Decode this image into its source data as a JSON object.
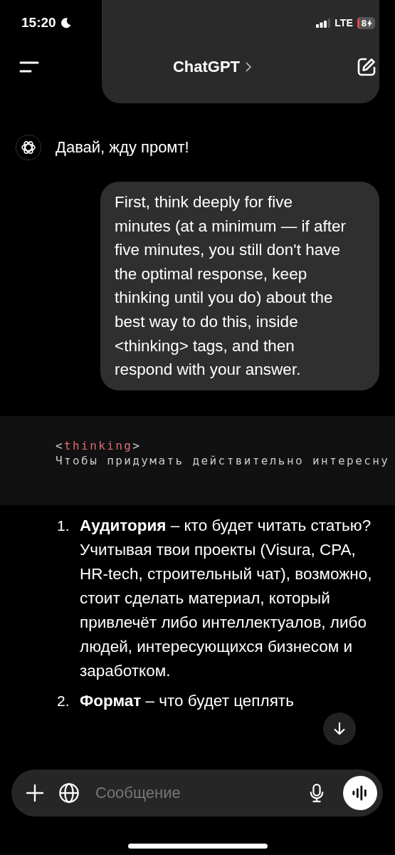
{
  "status_bar": {
    "time": "15:20",
    "network": "LTE",
    "battery": "8"
  },
  "header": {
    "title": "ChatGPT"
  },
  "assistant_reply": {
    "text": "Давай, жду промт!"
  },
  "user_message": {
    "text": "First, think deeply for five minutes (at a minimum — if after five minutes, you still don't have the optimal response, keep thinking until you do) about the best way to do this, inside <thinking> tags, and then respond with your answer."
  },
  "code_block": {
    "lines": [
      [
        {
          "kind": "punct",
          "text": "<"
        },
        {
          "kind": "tag",
          "text": "thinking"
        },
        {
          "kind": "punct",
          "text": ">"
        }
      ],
      [
        {
          "kind": "plain",
          "text": "Чтобы придумать действительно интересну"
        }
      ]
    ]
  },
  "list": [
    {
      "number": "1.",
      "text": "**Аудитория** – кто будет читать статью? Учитывая твои проекты (Visura, CPA, HR-tech, строительный чат), возможно, стоит сделать материал, который привлечёт либо интеллектуалов, либо людей, интересующихся бизнесом и заработком."
    },
    {
      "number": "2.",
      "text": "**Формат** – что будет цеплять"
    }
  ],
  "composer": {
    "placeholder": "Сообщение"
  }
}
